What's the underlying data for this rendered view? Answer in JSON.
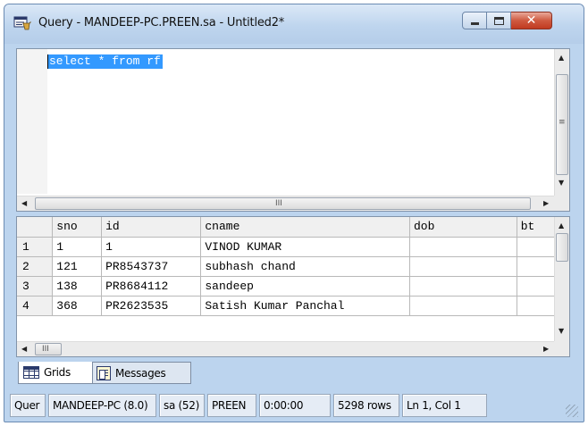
{
  "window": {
    "title": "Query - MANDEEP-PC.PREEN.sa - Untitled2*",
    "close_glyph": "✕"
  },
  "editor": {
    "query_text": "select * from rf"
  },
  "results": {
    "columns": [
      "sno",
      "id",
      "cname",
      "dob",
      "bt"
    ],
    "rows": [
      {
        "row_number": "1",
        "cells": [
          "1",
          "1",
          "VINOD KUMAR",
          "",
          ""
        ]
      },
      {
        "row_number": "2",
        "cells": [
          "121",
          "PR8543737",
          "subhash chand",
          "",
          ""
        ]
      },
      {
        "row_number": "3",
        "cells": [
          "138",
          "PR8684112",
          "sandeep",
          "",
          ""
        ]
      },
      {
        "row_number": "4",
        "cells": [
          "368",
          "PR2623535",
          "Satish Kumar Panchal",
          "",
          ""
        ]
      }
    ]
  },
  "scroll_glyphs": {
    "up": "▲",
    "down": "▼",
    "left": "◀",
    "right": "▶",
    "grip": "≡",
    "hgrip": "III"
  },
  "tabs": [
    {
      "label": "Grids",
      "icon": "grid-icon",
      "active": true
    },
    {
      "label": "Messages",
      "icon": "messages-icon",
      "active": false
    }
  ],
  "statusbar": {
    "mode": "Quer",
    "server": "MANDEEP-PC (8.0)",
    "user": "sa (52)",
    "database": "PREEN",
    "elapsed": "0:00:00",
    "row_count": "5298 rows",
    "cursor_position": "Ln 1, Col 1"
  },
  "colors": {
    "frame": "#bcd4ee",
    "selection": "#3399ff",
    "close_button": "#c03a20"
  }
}
